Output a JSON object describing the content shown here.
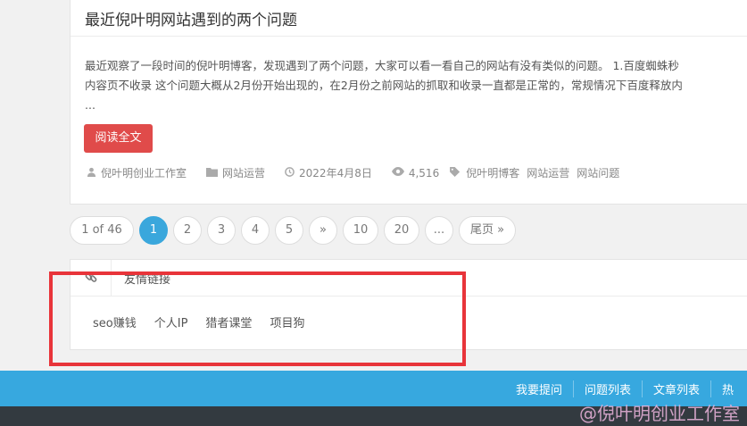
{
  "article": {
    "title": "最近倪叶明网站遇到的两个问题",
    "excerpt_lines": [
      "最近观察了一段时间的倪叶明博客，发现遇到了两个问题，大家可以看一看自己的网站有没有类似的问题。 1.百度蜘蛛秒",
      "内容页不收录 这个问题大概从2月份开始出现的，在2月份之前网站的抓取和收录一直都是正常的，常规情况下百度释放内",
      "..."
    ],
    "read_more": "阅读全文",
    "meta": {
      "author": "倪叶明创业工作室",
      "category": "网站运营",
      "date": "2022年4月8日",
      "views": "4,516",
      "tags": [
        "倪叶明博客",
        "网站运营",
        "网站问题"
      ]
    }
  },
  "pagination": {
    "items": [
      "1 of 46",
      "1",
      "2",
      "3",
      "4",
      "5",
      "»",
      "10",
      "20",
      "...",
      "尾页 »"
    ],
    "active_index": 1
  },
  "friend_links": {
    "title": "友情链接",
    "links": [
      "seo赚钱",
      "个人IP",
      "猎者课堂",
      "项目狗"
    ]
  },
  "footer": {
    "links": [
      "我要提问",
      "问题列表",
      "文章列表",
      "热"
    ]
  },
  "watermark": "@倪叶明创业工作室",
  "colors": {
    "accent_blue": "#37a8df",
    "read_more_red": "#e04b4a",
    "highlight_frame": "#e8343a"
  }
}
